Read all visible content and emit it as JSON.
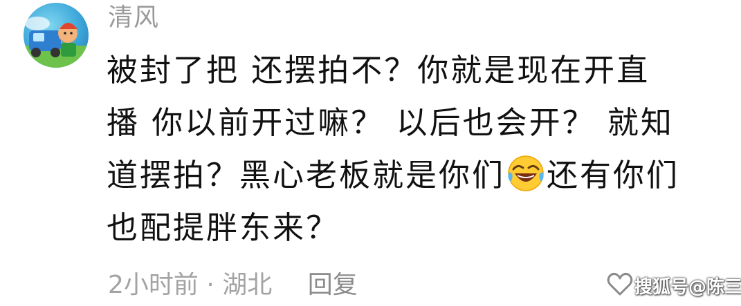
{
  "comment": {
    "username": "清风",
    "avatar_icon": "cartoon-avatar-icon",
    "text_part1": "被封了把 还摆拍不？你就是现在开直播 你以前开过嘛？ 以后也会开？ 就知道摆拍？黑心老板就是你们",
    "emoji_icon": "laughing-crying-emoji-icon",
    "text_part2": "还有你们也配提胖东来？",
    "time": "2小时前",
    "separator": "·",
    "location": "湖北",
    "reply_label": "回复",
    "like_icon": "heart-outline-icon"
  },
  "watermark": {
    "text": "搜狐号@陈三"
  }
}
